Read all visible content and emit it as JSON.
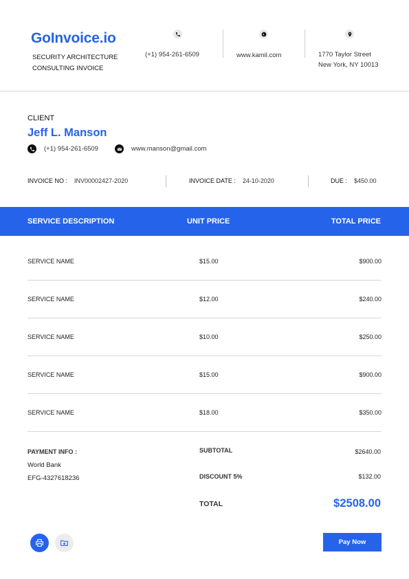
{
  "header": {
    "brand": "GoInvoice.io",
    "subtitle": "SECURITY ARCHITECTURE CONSULTING INVOICE",
    "phone": "(+1) 954-261-6509",
    "website": "www.kamil.com",
    "address_line1": "1770 Taylor Street",
    "address_line2": "New York, NY 10013",
    "icons": [
      "phone-icon",
      "globe-icon",
      "location-pin-icon"
    ]
  },
  "client": {
    "label": "CLIENT",
    "name": "Jeff L. Manson",
    "phone": "(+1) 954-261-6509",
    "email": "www.manson@gmail.com"
  },
  "meta": {
    "invoice_no_label": "INVOICE NO :",
    "invoice_no": "INV00002427-2020",
    "invoice_date_label": "INVOICE DATE :",
    "invoice_date": "24-10-2020",
    "due_label": "DUE :",
    "due": "$450.00"
  },
  "table": {
    "headers": [
      "SERVICE DESCRIPTION",
      "UNIT PRICE",
      "TOTAL PRICE"
    ],
    "rows": [
      {
        "name": "SERVICE NAME",
        "unit_price": "$15.00",
        "total_price": "$900.00"
      },
      {
        "name": "SERVICE NAME",
        "unit_price": "$12.00",
        "total_price": "$240.00"
      },
      {
        "name": "SERVICE NAME",
        "unit_price": "$10.00",
        "total_price": "$250.00"
      },
      {
        "name": "SERVICE NAME",
        "unit_price": "$15.00",
        "total_price": "$900.00"
      },
      {
        "name": "SERVICE NAME",
        "unit_price": "$18.00",
        "total_price": "$350.00"
      }
    ]
  },
  "payment": {
    "label": "PAYMENT INFO :",
    "bank": "World Bank",
    "account": "EFG-4327618236"
  },
  "summary": {
    "subtotal_label": "SUBTOTAL",
    "subtotal": "$2640.00",
    "discount_label": "DISCOUNT 5%",
    "discount": "$132.00",
    "total_label": "TOTAL",
    "total": "$2508.00"
  },
  "actions": {
    "pay_now": "Pay Now"
  },
  "colors": {
    "accent": "#2563eb"
  }
}
